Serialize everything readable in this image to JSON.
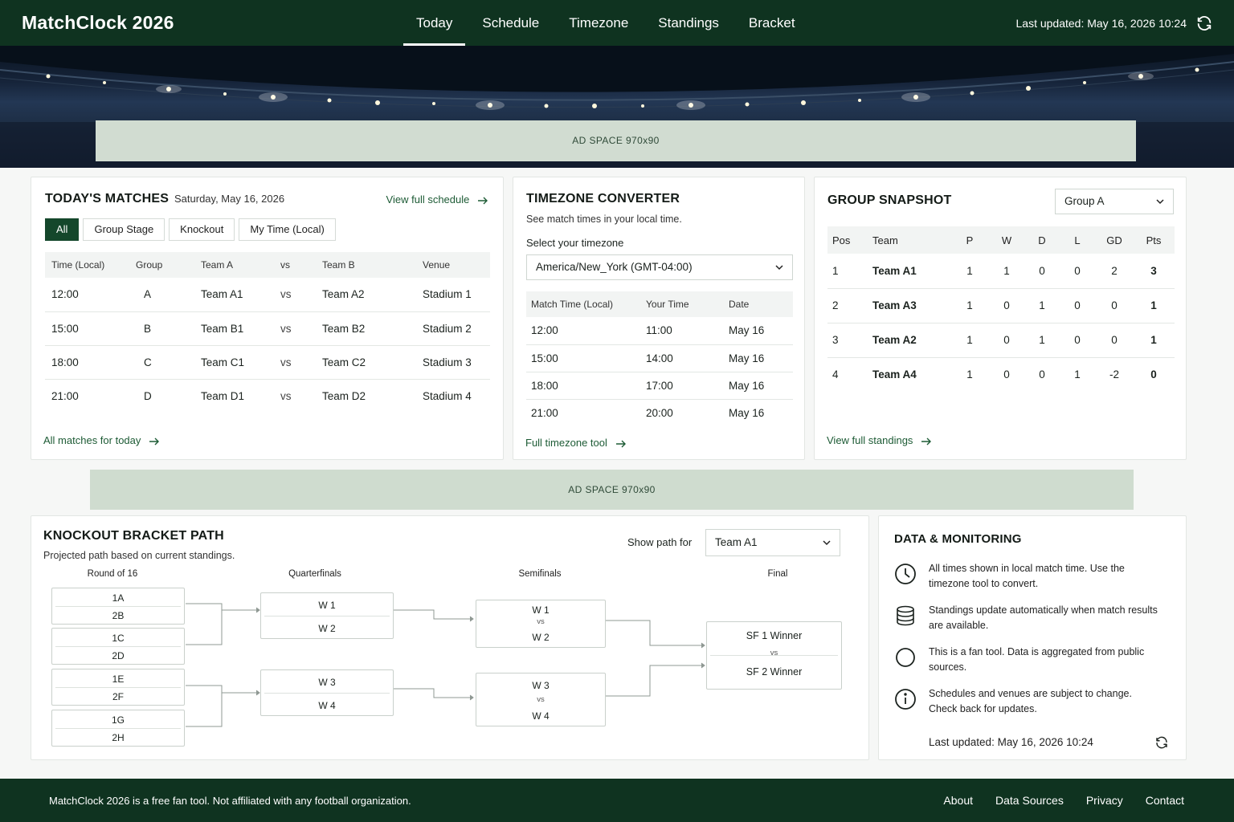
{
  "header": {
    "brand": "MatchClock 2026",
    "nav": [
      "Today",
      "Schedule",
      "Timezone",
      "Standings",
      "Bracket"
    ],
    "active_nav": "Today",
    "last_updated": "Last updated: May 16, 2026 10:24",
    "refresh_icon": "refresh-icon"
  },
  "ads": {
    "top": "AD SPACE  970x90",
    "middle": "AD SPACE  970x90"
  },
  "matches": {
    "title": "TODAY'S MATCHES",
    "date": "Saturday, May 16, 2026",
    "view_schedule": "View full schedule",
    "filters": [
      "All",
      "Group Stage",
      "Knockout",
      "My Time (Local)"
    ],
    "active_filter": "All",
    "columns": [
      "Time (Local)",
      "Group",
      "Team A",
      "vs",
      "Team B",
      "Venue"
    ],
    "rows": [
      {
        "time": "12:00",
        "group": "A",
        "team_a": "Team A1",
        "vs": "vs",
        "team_b": "Team A2",
        "venue": "Stadium 1"
      },
      {
        "time": "15:00",
        "group": "B",
        "team_a": "Team B1",
        "vs": "vs",
        "team_b": "Team B2",
        "venue": "Stadium 2"
      },
      {
        "time": "18:00",
        "group": "C",
        "team_a": "Team C1",
        "vs": "vs",
        "team_b": "Team C2",
        "venue": "Stadium 3"
      },
      {
        "time": "21:00",
        "group": "D",
        "team_a": "Team D1",
        "vs": "vs",
        "team_b": "Team D2",
        "venue": "Stadium 4"
      }
    ],
    "bottom_link": "All matches for today"
  },
  "timezone": {
    "title": "TIMEZONE CONVERTER",
    "subtitle": "See match times in your local time.",
    "select_label": "Select your timezone",
    "selected": "America/New_York (GMT-04:00)",
    "columns": [
      "Match Time (Local)",
      "Your Time",
      "Date"
    ],
    "rows": [
      {
        "match": "12:00",
        "yours": "11:00",
        "date": "May 16"
      },
      {
        "match": "15:00",
        "yours": "14:00",
        "date": "May 16"
      },
      {
        "match": "18:00",
        "yours": "17:00",
        "date": "May 16"
      },
      {
        "match": "21:00",
        "yours": "20:00",
        "date": "May 16"
      }
    ],
    "bottom_link": "Full timezone tool"
  },
  "group": {
    "title": "GROUP SNAPSHOT",
    "selected": "Group A",
    "columns": [
      "Pos",
      "Team",
      "P",
      "W",
      "D",
      "L",
      "GD",
      "Pts"
    ],
    "rows": [
      {
        "pos": "1",
        "team": "Team A1",
        "p": "1",
        "w": "1",
        "d": "0",
        "l": "0",
        "gd": "2",
        "pts": "3"
      },
      {
        "pos": "2",
        "team": "Team A3",
        "p": "1",
        "w": "0",
        "d": "1",
        "l": "0",
        "gd": "0",
        "pts": "1"
      },
      {
        "pos": "3",
        "team": "Team A2",
        "p": "1",
        "w": "0",
        "d": "1",
        "l": "0",
        "gd": "0",
        "pts": "1"
      },
      {
        "pos": "4",
        "team": "Team A4",
        "p": "1",
        "w": "0",
        "d": "0",
        "l": "1",
        "gd": "-2",
        "pts": "0"
      }
    ],
    "bottom_link": "View full standings"
  },
  "bracket": {
    "title": "KNOCKOUT BRACKET PATH",
    "subtitle": "Projected path based on current standings.",
    "show_label": "Show path for",
    "selected": "Team A1",
    "rounds": [
      "Round of 16",
      "Quarterfinals",
      "Semifinals",
      "Final"
    ],
    "r16": [
      [
        "1A",
        "2B"
      ],
      [
        "1C",
        "2D"
      ],
      [
        "1E",
        "2F"
      ],
      [
        "1G",
        "2H"
      ]
    ],
    "qf": [
      [
        "W 1",
        "W 2"
      ],
      [
        "W 3",
        "W 4"
      ]
    ],
    "sf": [
      [
        "W 1",
        "vs",
        "W 2"
      ],
      [
        "W 3",
        "vs",
        "W 4"
      ]
    ],
    "final": [
      "SF 1 Winner",
      "vs",
      "SF 2 Winner"
    ]
  },
  "monitoring": {
    "title": "DATA & MONITORING",
    "items": [
      {
        "icon": "clock-icon",
        "text": "All times shown in local match time. Use the timezone tool to convert."
      },
      {
        "icon": "database-icon",
        "text": "Standings update automatically when match results are available."
      },
      {
        "icon": "circle-icon",
        "text": "This is a fan tool. Data is aggregated from public sources."
      },
      {
        "icon": "info-icon",
        "text": "Schedules and venues are subject to change. Check back for updates."
      }
    ],
    "last_updated": "Last updated: May 16, 2026  10:24"
  },
  "footer": {
    "note": "MatchClock 2026 is a free fan tool. Not affiliated with any football organization.",
    "links": [
      "About",
      "Data Sources",
      "Privacy",
      "Contact"
    ]
  },
  "colors": {
    "brand_dark": "#0f3320",
    "accent": "#14472b",
    "link": "#1d5b35",
    "ad_bg": "#d1dcd1"
  }
}
